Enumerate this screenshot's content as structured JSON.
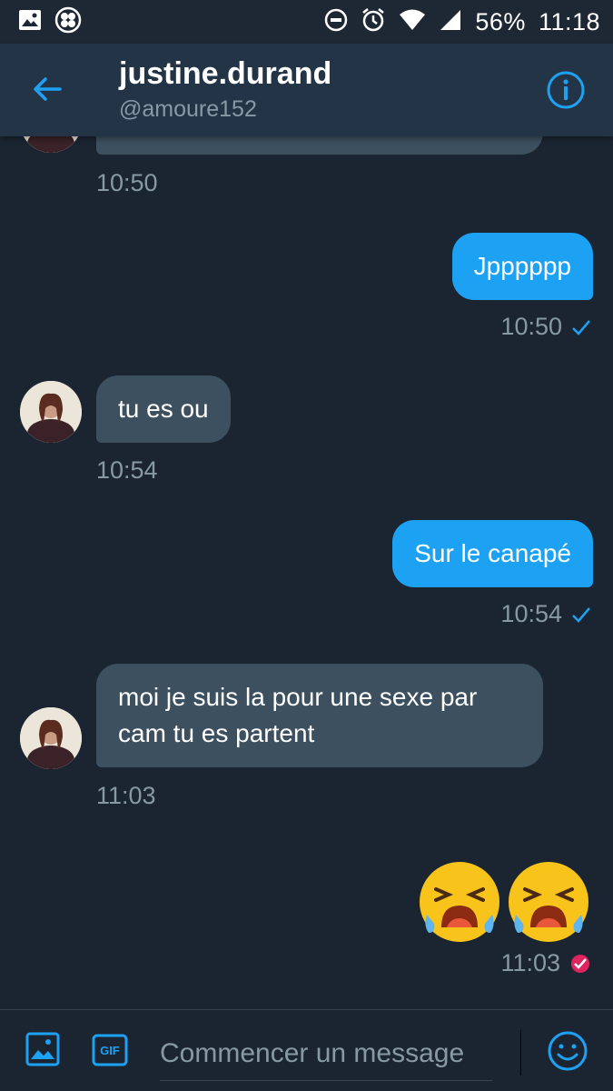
{
  "status_bar": {
    "battery": "56%",
    "time": "11:18"
  },
  "header": {
    "title": "justine.durand",
    "handle": "@amoure152"
  },
  "messages": [
    {
      "direction": "in",
      "text": "",
      "time": "10:50",
      "partial": true
    },
    {
      "direction": "out",
      "text": "Jpppppp",
      "time": "10:50",
      "status": "sent"
    },
    {
      "direction": "in",
      "text": "tu es ou",
      "time": "10:54"
    },
    {
      "direction": "out",
      "text": "Sur le canapé",
      "time": "10:54",
      "status": "sent"
    },
    {
      "direction": "in",
      "lines": [
        "moi je suis la pour une sexe par",
        "cam tu es partent"
      ],
      "time": "11:03"
    },
    {
      "direction": "out",
      "emoji": [
        "crying-face",
        "crying-face"
      ],
      "time": "11:03",
      "status": "read"
    }
  ],
  "composer": {
    "placeholder": "Commencer un message",
    "gif_label": "GIF"
  },
  "colors": {
    "background": "#1b2532",
    "header": "#243447",
    "accent": "#1da1f2",
    "incoming_bubble": "#3d5060",
    "muted_text": "#8899a6",
    "read_check": "#e0245e"
  }
}
